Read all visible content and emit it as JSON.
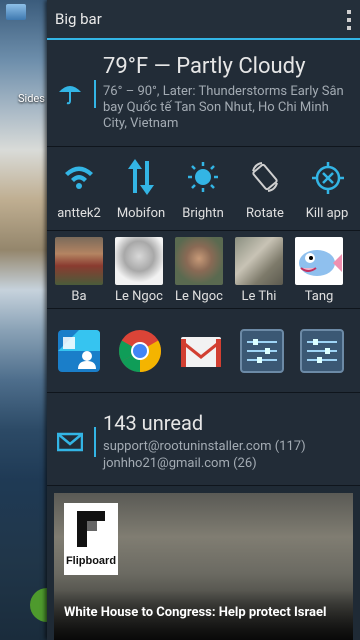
{
  "wallpaper": {
    "app_label": "Sides"
  },
  "topbar": {
    "title": "Big bar"
  },
  "weather": {
    "headline": "79°F — Partly Cloudy",
    "detail": "76° – 90°, Later: Thunderstorms Early Sân bay Quốc tế Tan Son Nhut, Ho Chi Minh City, Vietnam"
  },
  "toggles": [
    {
      "label": "anttek2",
      "icon": "wifi-icon"
    },
    {
      "label": "Mobifon",
      "icon": "mobile-data-icon"
    },
    {
      "label": "Brightn",
      "icon": "brightness-icon"
    },
    {
      "label": "Rotate",
      "icon": "rotate-icon"
    },
    {
      "label": "Kill app",
      "icon": "kill-app-icon"
    }
  ],
  "contacts": [
    {
      "name": "Ba"
    },
    {
      "name": "Le Ngoc"
    },
    {
      "name": "Le Ngoc"
    },
    {
      "name": "Le Thi"
    },
    {
      "name": "Tang"
    }
  ],
  "apps": [
    {
      "icon": "contacts-app-icon"
    },
    {
      "icon": "chrome-icon"
    },
    {
      "icon": "gmail-icon"
    },
    {
      "icon": "settings-app-icon"
    },
    {
      "icon": "settings-app-icon"
    }
  ],
  "email": {
    "unread": "143 unread",
    "accounts": [
      "support@rootuninstaller.com (117)",
      "jonhho21@gmail.com (26)"
    ]
  },
  "news": {
    "brand": "Flipboard",
    "headline": "White House to Congress: Help protect Israel"
  },
  "colors": {
    "accent": "#33b5e5",
    "panel": "#1f2a35"
  }
}
